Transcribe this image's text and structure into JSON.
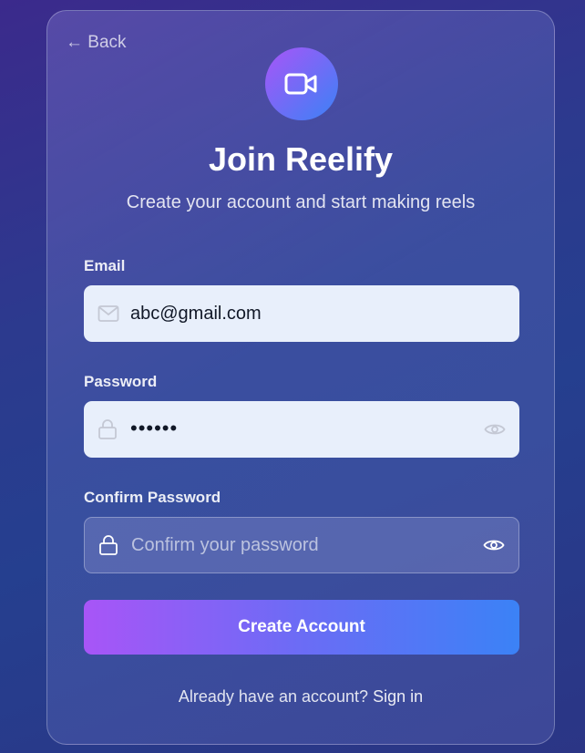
{
  "back": {
    "label": "← Back"
  },
  "logo": {
    "icon": "video-camera-icon"
  },
  "heading": {
    "title": "Join Reelify",
    "subtitle": "Create your account and start making reels"
  },
  "form": {
    "email": {
      "label": "Email",
      "value": "abc@gmail.com",
      "icon": "mail-icon"
    },
    "password": {
      "label": "Password",
      "masked_value": "••••••",
      "icon": "lock-icon",
      "toggle_icon": "eye-icon"
    },
    "confirm_password": {
      "label": "Confirm Password",
      "placeholder": "Confirm your password",
      "icon": "lock-icon",
      "toggle_icon": "eye-icon"
    },
    "submit_label": "Create Account"
  },
  "footer": {
    "prompt": "Already have an account?",
    "link_label": "Sign in"
  },
  "colors": {
    "accent_start": "#a855f7",
    "accent_end": "#3b82f6"
  }
}
